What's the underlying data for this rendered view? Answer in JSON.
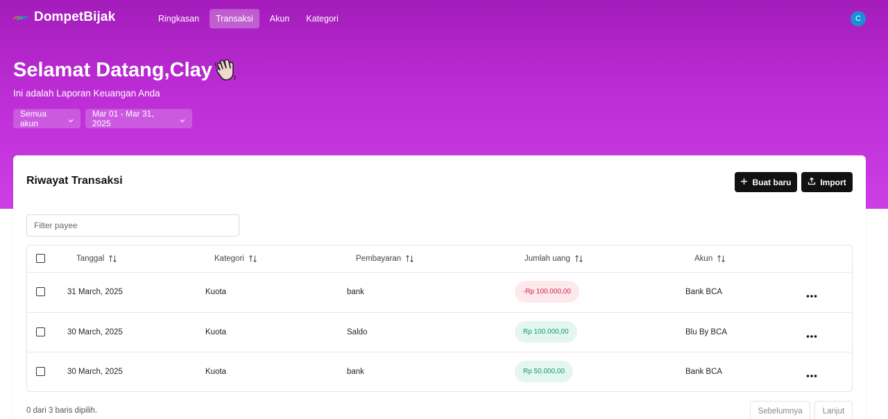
{
  "brand": {
    "name": "DompetBijak",
    "logo_icon": "wallet-logo-icon"
  },
  "nav": {
    "items": [
      {
        "label": "Ringkasan",
        "active": false
      },
      {
        "label": "Transaksi",
        "active": true
      },
      {
        "label": "Akun",
        "active": false
      },
      {
        "label": "Kategori",
        "active": false
      }
    ],
    "avatar_initial": "C"
  },
  "hero": {
    "welcome": "Selamat Datang,Clay",
    "wave_icon": "waving-hand-icon",
    "subtitle": "Ini adalah Laporan Keuangan Anda",
    "account_filter": "Semua akun",
    "date_filter": "Mar 01 - Mar 31, 2025"
  },
  "card": {
    "title": "Riwayat Transaksi",
    "new_button": "Buat baru",
    "import_button": "Import",
    "filter_placeholder": "Filter payee"
  },
  "table": {
    "columns": [
      "Tanggal",
      "Kategori",
      "Pembayaran",
      "Jumlah uang",
      "Akun"
    ],
    "rows": [
      {
        "date": "31 March, 2025",
        "category": "Kuota",
        "payee": "bank",
        "amount": "-Rp 100.000,00",
        "amount_type": "negative",
        "account": "Bank BCA"
      },
      {
        "date": "30 March, 2025",
        "category": "Kuota",
        "payee": "Saldo",
        "amount": "Rp 100.000,00",
        "amount_type": "positive",
        "account": "Blu By BCA"
      },
      {
        "date": "30 March, 2025",
        "category": "Kuota",
        "payee": "bank",
        "amount": "Rp 50.000,00",
        "amount_type": "positive",
        "account": "Bank BCA"
      }
    ]
  },
  "footer": {
    "selection_text": "0 dari 3 baris dipilih.",
    "prev_label": "Sebelumnya",
    "next_label": "Lanjut"
  },
  "colors": {
    "hero_top": "#a31cba",
    "hero_bottom": "#cc3fe4",
    "negative": "#d61f48",
    "positive": "#149a66",
    "avatar": "#1a8fd6"
  }
}
